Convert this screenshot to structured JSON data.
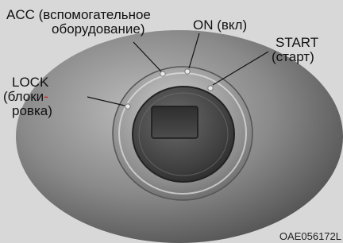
{
  "labels": {
    "acc_line1": "ACC (вспомогательное",
    "acc_line2": "оборудование)",
    "on": "ON (вкл)",
    "start_line1": "START",
    "start_line2": "(старт)",
    "lock_line1": "LOCK",
    "lock_line2a": "(блоки",
    "lock_hyphen": "-",
    "lock_line3": "ровка)"
  },
  "figure_code": "OAE056172L",
  "colors": {
    "background": "#d8d8d8",
    "hyphen_red": "#cc1f1f"
  }
}
